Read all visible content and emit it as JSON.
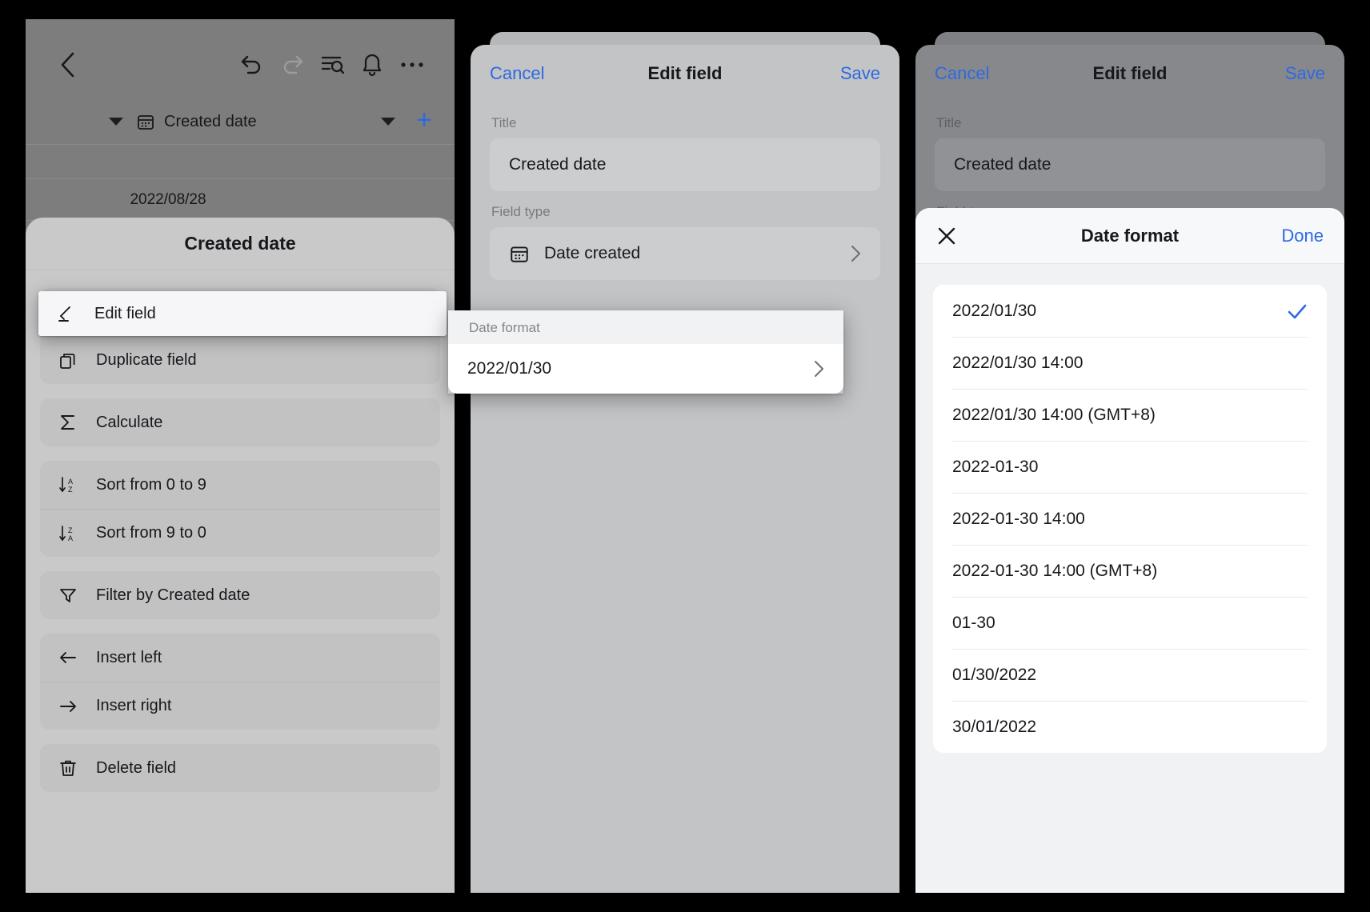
{
  "panel1": {
    "toolbar": {
      "back_icon": "chevron-left-icon",
      "undo_icon": "undo-icon",
      "redo_icon": "redo-icon",
      "search_icon": "search-in-list-icon",
      "bell_icon": "bell-icon",
      "more_icon": "ellipsis-icon"
    },
    "field_bar": {
      "field_icon": "calendar-icon",
      "field_name": "Created date",
      "add_label": "+"
    },
    "grid": {
      "cell_value": "2022/08/28"
    },
    "action_sheet": {
      "title": "Created date",
      "groups": [
        {
          "items": [
            {
              "label": "Edit field",
              "icon": "pencil-icon",
              "highlighted": true
            },
            {
              "label": "Duplicate field",
              "icon": "duplicate-icon"
            }
          ]
        },
        {
          "items": [
            {
              "label": "Calculate",
              "icon": "sigma-icon"
            }
          ]
        },
        {
          "items": [
            {
              "label": "Sort from 0 to 9",
              "icon": "sort-asc-icon"
            },
            {
              "label": "Sort from 9 to 0",
              "icon": "sort-desc-icon"
            }
          ]
        },
        {
          "items": [
            {
              "label": "Filter by Created date",
              "icon": "filter-icon"
            }
          ]
        },
        {
          "items": [
            {
              "label": "Insert left",
              "icon": "arrow-left-icon"
            },
            {
              "label": "Insert right",
              "icon": "arrow-right-icon"
            }
          ]
        },
        {
          "items": [
            {
              "label": "Delete field",
              "icon": "trash-icon"
            }
          ]
        }
      ],
      "highlight_row_label": "Edit field"
    }
  },
  "panel2": {
    "header": {
      "cancel": "Cancel",
      "title": "Edit field",
      "save": "Save"
    },
    "title_label": "Title",
    "title_value": "Created date",
    "field_type_label": "Field type",
    "field_type_value": "Date created",
    "field_type_icon": "calendar-icon",
    "date_format_label": "Date format",
    "date_format_value": "2022/01/30",
    "chevron_icon": "chevron-right-icon"
  },
  "panel3": {
    "header": {
      "cancel": "Cancel",
      "title": "Edit field",
      "save": "Save"
    },
    "title_label": "Title",
    "title_value": "Created date",
    "field_type_label": "Field type",
    "format_sheet": {
      "close_icon": "close-icon",
      "title": "Date format",
      "done": "Done",
      "check_icon": "check-icon",
      "options": [
        {
          "label": "2022/01/30",
          "selected": true
        },
        {
          "label": "2022/01/30 14:00",
          "selected": false
        },
        {
          "label": "2022/01/30 14:00 (GMT+8)",
          "selected": false
        },
        {
          "label": "2022-01-30",
          "selected": false
        },
        {
          "label": "2022-01-30 14:00",
          "selected": false
        },
        {
          "label": "2022-01-30 14:00 (GMT+8)",
          "selected": false
        },
        {
          "label": "01-30",
          "selected": false
        },
        {
          "label": "01/30/2022",
          "selected": false
        },
        {
          "label": "30/01/2022",
          "selected": false
        }
      ]
    }
  },
  "colors": {
    "accent": "#2d6ae0",
    "text": "#16181c",
    "muted": "#787a7e"
  }
}
